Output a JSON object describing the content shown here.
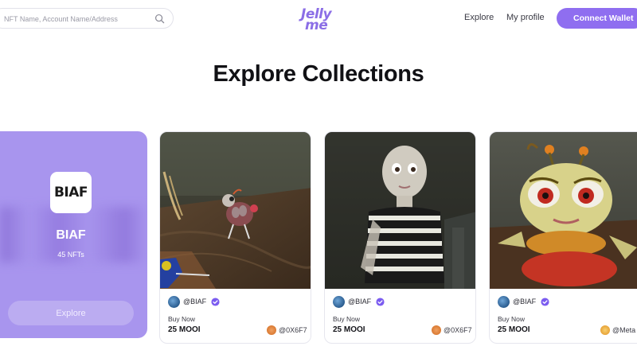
{
  "header": {
    "search": {
      "placeholder": "NFT Name, Account Name/Address",
      "icon": "search-icon"
    },
    "logo": {
      "line1": "Jelly",
      "line2": "me"
    },
    "nav": {
      "explore_label": "Explore",
      "profile_label": "My profile"
    },
    "connect_label": "Connect Wallet",
    "accent_color": "#8f6ef0"
  },
  "page": {
    "title": "Explore Collections"
  },
  "collection": {
    "logo_text": "BIAF",
    "name": "BIAF",
    "count": "45 NFTs",
    "explore_label": "Explore",
    "bg_color": "#a895ee"
  },
  "nfts": [
    {
      "owner": "@BIAF",
      "buy_label": "Buy Now",
      "price": "25 MOOI",
      "creator": "@0X6F7",
      "scene": "bug-on-wood"
    },
    {
      "owner": "@BIAF",
      "buy_label": "Buy Now",
      "price": "25 MOOI",
      "creator": "@0X6F7",
      "scene": "striped-figure"
    },
    {
      "owner": "@BIAF",
      "buy_label": "Buy Now",
      "price": "25 MOOI",
      "creator": "@Meta",
      "scene": "bug-closeup"
    }
  ]
}
